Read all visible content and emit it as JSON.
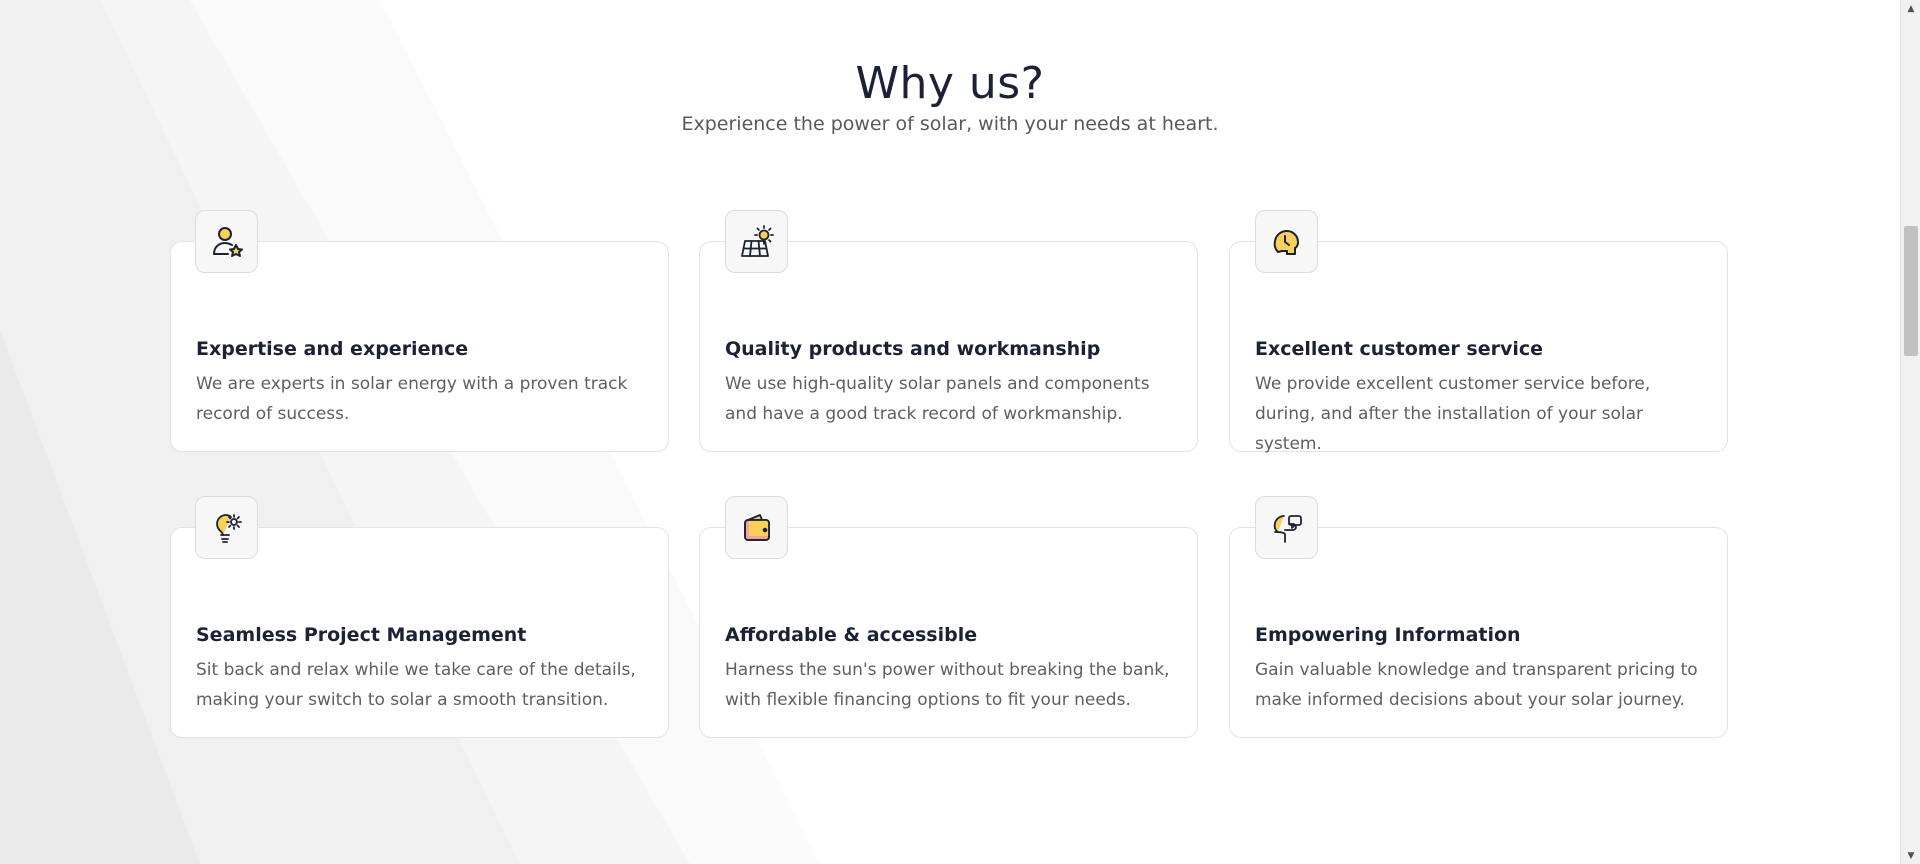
{
  "section": {
    "title": "Why us?",
    "subtitle": "Experience the power of solar, with your needs at heart."
  },
  "cards": [
    {
      "icon": "user-star-icon",
      "title": "Expertise and experience",
      "desc": "We are experts in solar energy with a proven track record of success."
    },
    {
      "icon": "solar-panel-icon",
      "title": "Quality products and workmanship",
      "desc": "We use high-quality solar panels and components and have a good track record of workmanship."
    },
    {
      "icon": "customer-service-head-icon",
      "title": "Excellent customer service",
      "desc": "We provide excellent customer service before, during, and after the installation of your solar system."
    },
    {
      "icon": "lightbulb-gear-icon",
      "title": "Seamless Project Management",
      "desc": "Sit back and relax while we take care of the details, making your switch to solar a smooth transition."
    },
    {
      "icon": "wallet-icon",
      "title": "Affordable & accessible",
      "desc": "Harness the sun's power without breaking the bank, with flexible financing options to fit your needs."
    },
    {
      "icon": "head-chat-icon",
      "title": "Empowering Information",
      "desc": "Gain valuable knowledge and transparent pricing to make informed decisions about your solar journey."
    }
  ],
  "colors": {
    "accent_yellow": "#f9d15a",
    "accent_pink": "#f6a3a0",
    "icon_stroke": "#1c2236",
    "title_color": "#1c2236",
    "text_color": "#5b5f66"
  }
}
